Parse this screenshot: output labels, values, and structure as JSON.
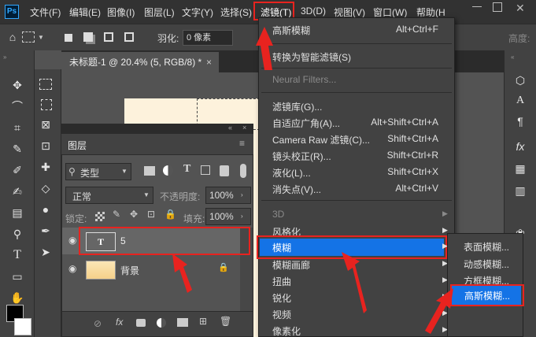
{
  "app": {
    "logo": "Ps"
  },
  "menubar": {
    "items": [
      "文件(F)",
      "编辑(E)",
      "图像(I)",
      "图层(L)",
      "文字(Y)",
      "选择(S)",
      "滤镜(T)",
      "3D(D)",
      "视图(V)",
      "窗口(W)",
      "帮助(H"
    ]
  },
  "options": {
    "feather_label": "羽化:",
    "feather_value": "0 像素",
    "height_label": "高度:"
  },
  "document": {
    "tab_title": "未标题-1 @ 20.4% (5, RGB/8) *",
    "close_glyph": "×"
  },
  "layers_panel": {
    "title": "图层",
    "filter_kind": "类型",
    "blend_mode": "正常",
    "opacity_label": "不透明度:",
    "opacity_value": "100%",
    "lock_label": "锁定:",
    "fill_label": "填充:",
    "fill_value": "100%",
    "layers": [
      {
        "name": "5",
        "type": "text",
        "thumb": "T"
      },
      {
        "name": "背景",
        "type": "image"
      }
    ]
  },
  "filter_menu": {
    "items": [
      {
        "label": "高斯模糊",
        "shortcut": "Alt+Ctrl+F"
      },
      {
        "label": "转换为智能滤镜(S)",
        "shortcut": ""
      },
      {
        "label": "Neural Filters...",
        "shortcut": "",
        "disabled": true
      },
      {
        "label": "滤镜库(G)...",
        "shortcut": ""
      },
      {
        "label": "自适应广角(A)...",
        "shortcut": "Alt+Shift+Ctrl+A"
      },
      {
        "label": "Camera Raw 滤镜(C)...",
        "shortcut": "Shift+Ctrl+A"
      },
      {
        "label": "镜头校正(R)...",
        "shortcut": "Shift+Ctrl+R"
      },
      {
        "label": "液化(L)...",
        "shortcut": "Shift+Ctrl+X"
      },
      {
        "label": "消失点(V)...",
        "shortcut": "Alt+Ctrl+V"
      },
      {
        "label": "3D",
        "shortcut": "",
        "disabled": true,
        "submenu": true
      },
      {
        "label": "风格化",
        "shortcut": "",
        "submenu": true
      },
      {
        "label": "模糊",
        "shortcut": "",
        "submenu": true,
        "highlighted": true
      },
      {
        "label": "模糊画廊",
        "shortcut": "",
        "submenu": true
      },
      {
        "label": "扭曲",
        "shortcut": "",
        "submenu": true
      },
      {
        "label": "锐化",
        "shortcut": "",
        "submenu": true
      },
      {
        "label": "视频",
        "shortcut": "",
        "submenu": true
      },
      {
        "label": "像素化",
        "shortcut": "",
        "submenu": true
      }
    ]
  },
  "blur_submenu": {
    "items": [
      "表面模糊...",
      "动感模糊...",
      "方框模糊...",
      "高斯模糊..."
    ]
  },
  "colors": {
    "highlight": "#1473e6",
    "annotation": "#e8231f"
  }
}
